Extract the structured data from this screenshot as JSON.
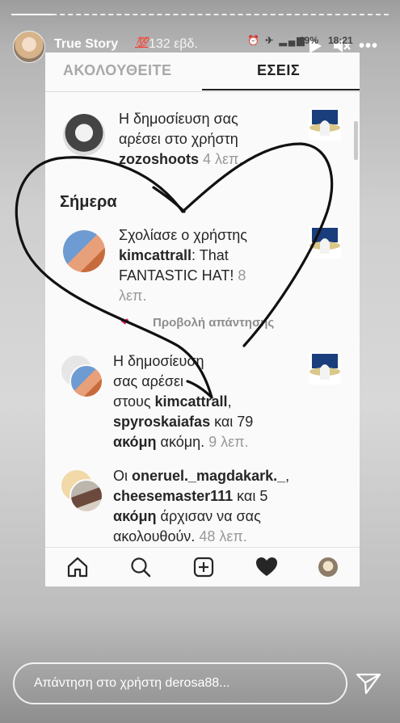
{
  "story": {
    "username": "True Story",
    "emoji": "💯",
    "time": "132 εβδ.",
    "progress": 0.11,
    "reply_placeholder": "Απάντηση στο χρήστη derosa88..."
  },
  "status_bar": {
    "battery": "69%",
    "clock": "18:21"
  },
  "tabs": [
    "ΑΚΟΛΟΥΘΕΙΤΕ",
    "ΕΣΕΙΣ"
  ],
  "notifications": [
    {
      "line1": "Η δημοσίευση σας",
      "line2": "αρέσει στο χρήστη",
      "user": "zozoshoots",
      "time": "4 λεπ."
    },
    {
      "line1": "Σχολίασε ο χρήστης",
      "user": "kimcattrall",
      "comment1": ": That",
      "comment2": "FANTASTIC HAT!",
      "time_inline": "8",
      "time_unit": "λεπ.",
      "reply_link": "Προβολή απάντησης"
    },
    {
      "line1": "Η δημοσίευση",
      "line2": "σας αρέσει",
      "line3_pre": "στους",
      "user1": "kimcattrall",
      "comma": ",",
      "user2": "spyroskaiafas",
      "and": "και 79",
      "others": "ακόμη",
      "others_tail": "ακόμη.",
      "time": "9 λεπ."
    },
    {
      "pre": "Οι",
      "user1": "oneruel._magdakark._",
      "comma": ",",
      "user2": "cheesemaster111",
      "and": "και 5",
      "others": "ακόμη",
      "tail": "άρχισαν να σας",
      "tail2": "ακολουθούν.",
      "time": "48 λεπ."
    }
  ],
  "section_today": "Σήμερα",
  "bottom_nav": [
    "home-icon",
    "search-icon",
    "new-post-icon",
    "activity-heart-icon",
    "profile-icon"
  ]
}
